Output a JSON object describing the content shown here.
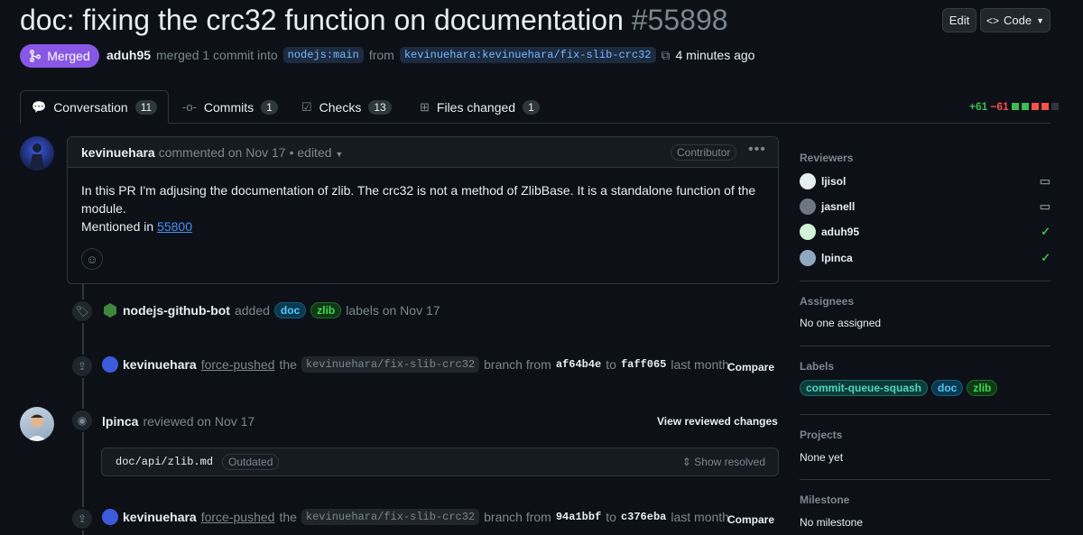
{
  "header": {
    "title": "doc: fixing the crc32 function on documentation",
    "number": "#55898",
    "edit_label": "Edit",
    "code_label": "Code",
    "state_label": "Merged",
    "author": "aduh95",
    "merged_text": "merged 1 commit into",
    "base_branch": "nodejs:main",
    "from_text": "from",
    "head_branch": "kevinuehara:kevinuehara/fix-slib-crc32",
    "time_ago": "4 minutes ago"
  },
  "tabs": [
    {
      "label": "Conversation",
      "count": "11",
      "icon": "comment-discussion-icon"
    },
    {
      "label": "Commits",
      "count": "1",
      "icon": "git-commit-icon"
    },
    {
      "label": "Checks",
      "count": "13",
      "icon": "checklist-icon"
    },
    {
      "label": "Files changed",
      "count": "1",
      "icon": "file-diff-icon"
    }
  ],
  "diffstat": {
    "additions": "+61",
    "deletions": "−61"
  },
  "comment": {
    "author": "kevinuehara",
    "meta": "commented on Nov 17",
    "edited": "• edited",
    "role": "Contributor",
    "body_line": "In this PR I'm adjusing the documentation of zlib. The crc32 is not a method of ZlibBase. It is a standalone function of the module.",
    "mention_prefix": "Mentioned in",
    "mention_link": "55800"
  },
  "events": {
    "labels_event": {
      "actor": "nodejs-github-bot",
      "action": "added",
      "labels": [
        "doc",
        "zlib"
      ],
      "suffix": "labels on Nov 17"
    },
    "push1": {
      "actor": "kevinuehara",
      "action": "force-pushed",
      "the": "the",
      "branch": "kevinuehara/fix-slib-crc32",
      "branch_text": "branch from",
      "from_sha": "af64b4e",
      "to": "to",
      "to_sha": "faff065",
      "when": "last month",
      "compare": "Compare"
    },
    "review": {
      "actor": "lpinca",
      "action": "reviewed on Nov 17",
      "view_changes": "View reviewed changes",
      "file_path": "doc/api/zlib.md",
      "outdated": "Outdated",
      "show_resolved": "Show resolved"
    },
    "push2": {
      "actor": "kevinuehara",
      "action": "force-pushed",
      "the": "the",
      "branch": "kevinuehara/fix-slib-crc32",
      "branch_text": "branch from",
      "from_sha": "94a1bbf",
      "to": "to",
      "to_sha": "c376eba",
      "when": "last month",
      "compare": "Compare"
    }
  },
  "sidebar": {
    "reviewers_title": "Reviewers",
    "reviewers": [
      {
        "name": "ljisol",
        "status": "comment-icon"
      },
      {
        "name": "jasnell",
        "status": "comment-icon"
      },
      {
        "name": "aduh95",
        "status": "check-icon"
      },
      {
        "name": "lpinca",
        "status": "check-icon"
      }
    ],
    "assignees_title": "Assignees",
    "assignees_value": "No one assigned",
    "labels_title": "Labels",
    "labels": [
      "commit-queue-squash",
      "doc",
      "zlib"
    ],
    "projects_title": "Projects",
    "projects_value": "None yet",
    "milestone_title": "Milestone",
    "milestone_value": "No milestone"
  },
  "colors": {
    "merged": "#8957e5",
    "add": "#3fb950",
    "del": "#f85149",
    "link": "#4493f8",
    "background": "#0d1117"
  }
}
